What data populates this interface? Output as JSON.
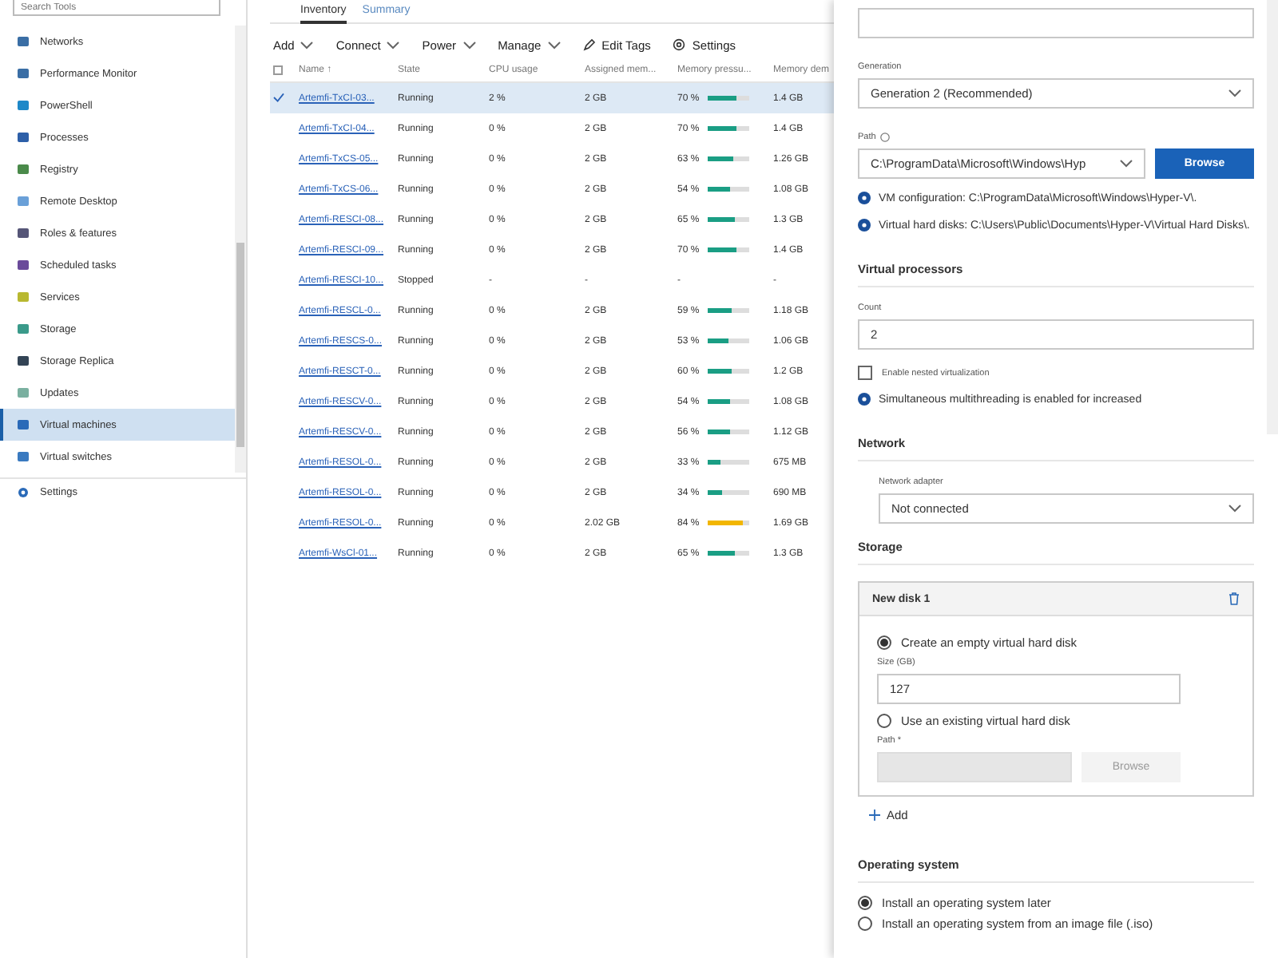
{
  "sidebar": {
    "search": {
      "placeholder": "Search Tools"
    },
    "items": [
      {
        "label": "Networks",
        "selected": false,
        "color": "#3a6ea5"
      },
      {
        "label": "Performance Monitor",
        "selected": false,
        "color": "#3a6ea5"
      },
      {
        "label": "PowerShell",
        "selected": false,
        "color": "#1e88c8"
      },
      {
        "label": "Processes",
        "selected": false,
        "color": "#2d5fa8"
      },
      {
        "label": "Registry",
        "selected": false,
        "color": "#4a8a4a"
      },
      {
        "label": "Remote Desktop",
        "selected": false,
        "color": "#6aa0d8"
      },
      {
        "label": "Roles & features",
        "selected": false,
        "color": "#555577"
      },
      {
        "label": "Scheduled tasks",
        "selected": false,
        "color": "#6a4a9a"
      },
      {
        "label": "Services",
        "selected": false,
        "color": "#b8b830"
      },
      {
        "label": "Storage",
        "selected": false,
        "color": "#3a9a8a"
      },
      {
        "label": "Storage Replica",
        "selected": false,
        "color": "#334455"
      },
      {
        "label": "Updates",
        "selected": false,
        "color": "#7ab0a0"
      },
      {
        "label": "Virtual machines",
        "selected": true,
        "color": "#2a6ab8"
      },
      {
        "label": "Virtual switches",
        "selected": false,
        "color": "#3a7ac0"
      }
    ],
    "settings": {
      "label": "Settings"
    }
  },
  "tabs": [
    {
      "label": "Inventory",
      "selected": true
    },
    {
      "label": "Summary",
      "selected": false
    }
  ],
  "toolbar": [
    {
      "label": "Add",
      "kind": "menu"
    },
    {
      "label": "Connect",
      "kind": "menu"
    },
    {
      "label": "Power",
      "kind": "menu"
    },
    {
      "label": "Manage",
      "kind": "menu"
    },
    {
      "label": "Edit Tags",
      "kind": "tags"
    },
    {
      "label": "Settings",
      "kind": "settings"
    }
  ],
  "table": {
    "all_selected": false,
    "columns": [
      "Name ↑",
      "State",
      "CPU usage",
      "Assigned mem...",
      "Memory pressu...",
      "Memory dem"
    ],
    "rows": [
      {
        "selected": true,
        "name": "Artemfi-TxCI-03...",
        "state": "Running",
        "cpu": "2 %",
        "assigned": "2 GB",
        "pressure": {
          "text": "70 %",
          "level": 0.7,
          "color": "#1a9e84"
        },
        "demand": "1.4 GB"
      },
      {
        "selected": false,
        "name": "Artemfi-TxCI-04...",
        "state": "Running",
        "cpu": "0 %",
        "assigned": "2 GB",
        "pressure": {
          "text": "70 %",
          "level": 0.7,
          "color": "#1a9e84"
        },
        "demand": "1.4 GB"
      },
      {
        "selected": false,
        "name": "Artemfi-TxCS-05...",
        "state": "Running",
        "cpu": "0 %",
        "assigned": "2 GB",
        "pressure": {
          "text": "63 %",
          "level": 0.63,
          "color": "#1a9e84"
        },
        "demand": "1.26 GB"
      },
      {
        "selected": false,
        "name": "Artemfi-TxCS-06...",
        "state": "Running",
        "cpu": "0 %",
        "assigned": "2 GB",
        "pressure": {
          "text": "54 %",
          "level": 0.54,
          "color": "#1a9e84"
        },
        "demand": "1.08 GB"
      },
      {
        "selected": false,
        "name": "Artemfi-RESCI-08...",
        "state": "Running",
        "cpu": "0 %",
        "assigned": "2 GB",
        "pressure": {
          "text": "65 %",
          "level": 0.65,
          "color": "#1a9e84"
        },
        "demand": "1.3 GB"
      },
      {
        "selected": false,
        "name": "Artemfi-RESCI-09...",
        "state": "Running",
        "cpu": "0 %",
        "assigned": "2 GB",
        "pressure": {
          "text": "70 %",
          "level": 0.7,
          "color": "#1a9e84"
        },
        "demand": "1.4 GB"
      },
      {
        "selected": false,
        "name": "Artemfi-RESCI-10...",
        "state": "Stopped",
        "cpu": "-",
        "assigned": "-",
        "pressure": {
          "text": "-"
        },
        "demand": "-"
      },
      {
        "selected": false,
        "name": "Artemfi-RESCL-0...",
        "state": "Running",
        "cpu": "0 %",
        "assigned": "2 GB",
        "pressure": {
          "text": "59 %",
          "level": 0.59,
          "color": "#1a9e84"
        },
        "demand": "1.18 GB"
      },
      {
        "selected": false,
        "name": "Artemfi-RESCS-0...",
        "state": "Running",
        "cpu": "0 %",
        "assigned": "2 GB",
        "pressure": {
          "text": "53 %",
          "level": 0.53,
          "color": "#1a9e84"
        },
        "demand": "1.06 GB"
      },
      {
        "selected": false,
        "name": "Artemfi-RESCT-0...",
        "state": "Running",
        "cpu": "0 %",
        "assigned": "2 GB",
        "pressure": {
          "text": "60 %",
          "level": 0.6,
          "color": "#1a9e84"
        },
        "demand": "1.2 GB"
      },
      {
        "selected": false,
        "name": "Artemfi-RESCV-0...",
        "state": "Running",
        "cpu": "0 %",
        "assigned": "2 GB",
        "pressure": {
          "text": "54 %",
          "level": 0.54,
          "color": "#1a9e84"
        },
        "demand": "1.08 GB"
      },
      {
        "selected": false,
        "name": "Artemfi-RESCV-0...",
        "state": "Running",
        "cpu": "0 %",
        "assigned": "2 GB",
        "pressure": {
          "text": "56 %",
          "level": 0.56,
          "color": "#1a9e84"
        },
        "demand": "1.12 GB"
      },
      {
        "selected": false,
        "name": "Artemfi-RESOL-0...",
        "state": "Running",
        "cpu": "0 %",
        "assigned": "2 GB",
        "pressure": {
          "text": "33 %",
          "level": 0.33,
          "color": "#1a9e84"
        },
        "demand": "675 MB"
      },
      {
        "selected": false,
        "name": "Artemfi-RESOL-0...",
        "state": "Running",
        "cpu": "0 %",
        "assigned": "2 GB",
        "pressure": {
          "text": "34 %",
          "level": 0.34,
          "color": "#1a9e84"
        },
        "demand": "690 MB"
      },
      {
        "selected": false,
        "name": "Artemfi-RESOL-0...",
        "state": "Running",
        "cpu": "0 %",
        "assigned": "2.02 GB",
        "pressure": {
          "text": "84 %",
          "level": 0.84,
          "color": "#f2b600"
        },
        "demand": "1.69 GB"
      },
      {
        "selected": false,
        "name": "Artemfi-WsCl-01...",
        "state": "Running",
        "cpu": "0 %",
        "assigned": "2 GB",
        "pressure": {
          "text": "65 %",
          "level": 0.65,
          "color": "#1a9e84"
        },
        "demand": "1.3 GB"
      }
    ]
  },
  "panel": {
    "generation": {
      "label": "Generation",
      "value": "Generation 2 (Recommended)"
    },
    "path": {
      "label": "Path",
      "value": "C:\\ProgramData\\Microsoft\\Windows\\Hyp",
      "button": "Browse"
    },
    "notes": [
      "VM configuration: C:\\ProgramData\\Microsoft\\Windows\\Hyper-V\\.",
      "Virtual hard disks: C:\\Users\\Public\\Documents\\Hyper-V\\Virtual Hard Disks\\."
    ],
    "processors": {
      "heading": "Virtual processors",
      "count_label": "Count",
      "count": "2",
      "nested": {
        "label": "Enable nested virtualization",
        "checked": false
      },
      "note": "Simultaneous multithreading is enabled for increased"
    },
    "network": {
      "heading": "Network",
      "adapter_label": "Network adapter",
      "adapter": "Not connected"
    },
    "storage": {
      "heading": "Storage",
      "disk": {
        "title": "New disk 1",
        "options": [
          {
            "label": "Create an empty virtual hard disk",
            "selected": true
          },
          {
            "label": "Use an existing virtual hard disk",
            "selected": false
          }
        ],
        "size_label": "Size (GB)",
        "size": "127",
        "path_label": "Path *",
        "browse": "Browse"
      },
      "add": "Add"
    },
    "os": {
      "heading": "Operating system",
      "options": [
        {
          "label": "Install an operating system later",
          "selected": true
        },
        {
          "label": "Install an operating system from an image file (.iso)",
          "selected": false
        }
      ]
    }
  }
}
